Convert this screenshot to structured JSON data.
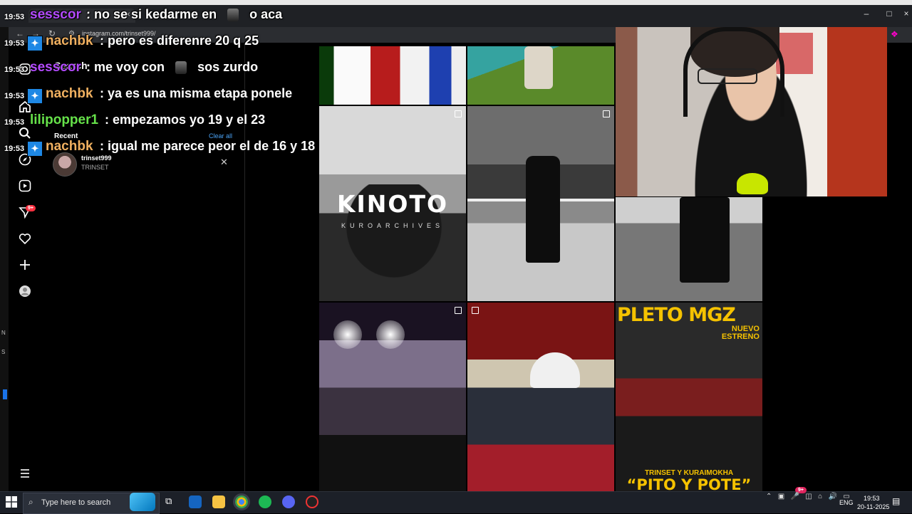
{
  "browser": {
    "url": "instagram.com/trinset999/"
  },
  "instagram": {
    "search": {
      "title": "Search",
      "recent_label": "Recent",
      "clear_all": "Clear all",
      "recent_items": [
        {
          "username": "trinset999",
          "name": "TRINSET"
        }
      ]
    },
    "notification_count": "9+",
    "grid": {
      "kinoto_title": "KINOTO",
      "kinoto_subtitle": "KUROARCHIVES",
      "pleto_title": "PLETO MGZ",
      "pleto_nuevo": "NUEVO",
      "pleto_estreno": "ESTRENO",
      "pleto_artists": "TRINSET Y KURAIMOKHA",
      "pleto_song": "“PITO Y POTE”"
    }
  },
  "chat": [
    {
      "time": "19:53",
      "user": "sesscor",
      "user_color": "#b44bff",
      "badge": false,
      "message": ": no se si kedarme en",
      "emote": true,
      "message2": "o aca"
    },
    {
      "time": "19:53",
      "user": "nachbk",
      "user_color": "#f0b060",
      "badge": true,
      "message": ": pero es diferenre 20 q 25"
    },
    {
      "time": "19:53",
      "user": "sesscor",
      "user_color": "#b44bff",
      "badge": false,
      "message": ": me voy con",
      "emote": true,
      "message2": "sos zurdo"
    },
    {
      "time": "19:53",
      "user": "nachbk",
      "user_color": "#f0b060",
      "badge": true,
      "message": ": ya es una misma etapa ponele"
    },
    {
      "time": "19:53",
      "user": "lilipopper1",
      "user_color": "#66e24a",
      "badge": false,
      "message": ": empezamos yo 19 y el 23"
    },
    {
      "time": "19:53",
      "user": "nachbk",
      "user_color": "#f0b060",
      "badge": true,
      "message": ": igual me parece peor el de 16 y 18"
    }
  ],
  "taskbar": {
    "search_placeholder": "Type here to search",
    "language": "ENG",
    "time": "19:53",
    "date": "20-11-2025",
    "float_badge": "9+"
  },
  "colors": {
    "accent_blue": "#4aa3f7",
    "notification_red": "#ff3040",
    "poster_yellow": "#f5c200"
  }
}
